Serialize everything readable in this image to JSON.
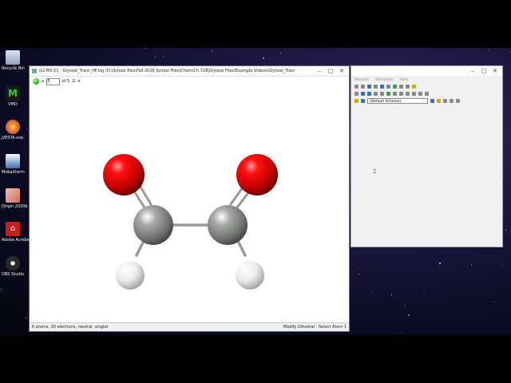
{
  "desktop": {
    "icons": [
      {
        "label": "Recycle Bin",
        "icon": "recycle-bin-icon",
        "color": "#8fa3b8"
      },
      {
        "label": "VMD",
        "icon": "vmd-icon",
        "color": "#2a8a3a"
      },
      {
        "label": "VESTA.exe",
        "icon": "vesta-icon",
        "color": "#e07a20"
      },
      {
        "label": "MobaXterm",
        "icon": "mobaxterm-icon",
        "color": "#3a6fb0"
      },
      {
        "label": "Origin 2020b",
        "icon": "origin-icon",
        "color": "#d66a5a"
      },
      {
        "label": "Adobe Acrobat",
        "icon": "acrobat-icon",
        "color": "#c81e1e"
      },
      {
        "label": "OBS Studio",
        "icon": "obs-icon",
        "color": "#2a2a2a"
      }
    ]
  },
  "gaussview": {
    "title": "G2:M3:V1 - Glyoxal_Trans_HF.log (D:\\School files\\Fall 2026 School Files\\Chem\\Ch 728\\Glyoxal Files\\Example Videos\\Glyoxal_Trans_HF.log)",
    "toolbar": {
      "frame_value": "5",
      "of_label": "of 5"
    },
    "status_left": "6 atoms, 30 electrons, neutral, singlet",
    "status_right": "Modify Dihedral : Select Atom 1",
    "colors": {
      "oxygen": "#e00000",
      "carbon": "#8a8c8a",
      "hydrogen": "#f2f2f2"
    }
  },
  "side_window": {
    "menu": [
      "Results",
      "Windows",
      "Help"
    ],
    "scheme": "(Default Scheme)"
  }
}
